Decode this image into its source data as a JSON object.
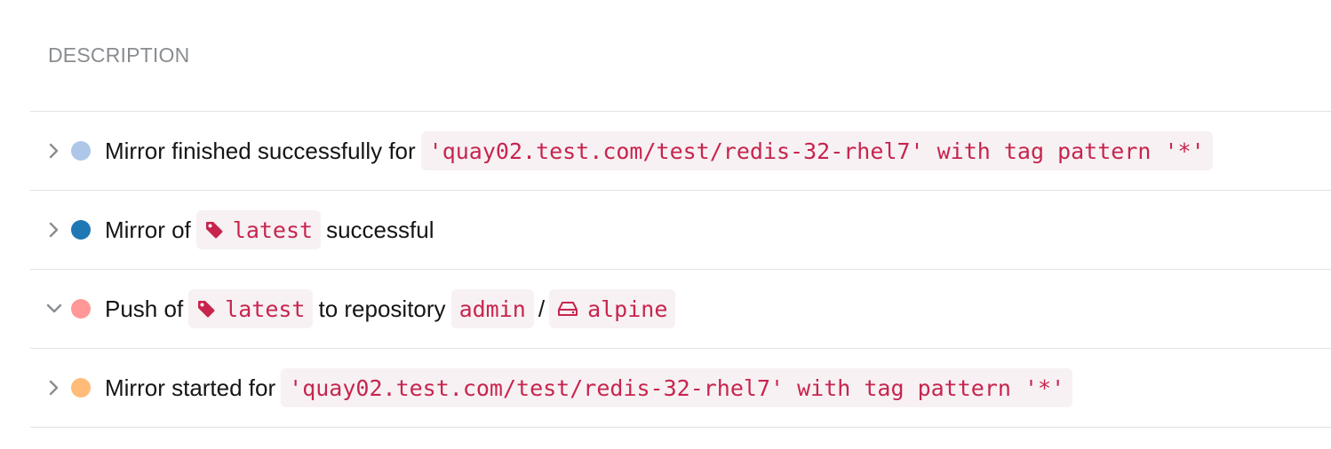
{
  "table": {
    "header": "DESCRIPTION",
    "rows": [
      {
        "expanded": false,
        "status_color": "#aec7e8",
        "prefix": "Mirror finished successfully for",
        "code": "'quay02.test.com/test/redis-32-rhel7' with tag pattern '*'"
      },
      {
        "expanded": false,
        "status_color": "#1f77b4",
        "prefix": "Mirror of",
        "tag": "latest",
        "suffix": "successful"
      },
      {
        "expanded": true,
        "status_color": "#ff9896",
        "prefix": "Push of",
        "tag": "latest",
        "middle": "to repository",
        "namespace": "admin",
        "separator": "/",
        "repository": "alpine"
      },
      {
        "expanded": false,
        "status_color": "#ffbb78",
        "prefix": "Mirror started for",
        "code": "'quay02.test.com/test/redis-32-rhel7' with tag pattern '*'"
      }
    ]
  },
  "icons": {
    "collapsed": "chevron-right-icon",
    "expanded": "chevron-down-icon",
    "tag": "tag-icon",
    "repository": "hdd-icon"
  },
  "colors": {
    "code_text": "#c7254e",
    "code_bg": "#f7f1f3"
  }
}
